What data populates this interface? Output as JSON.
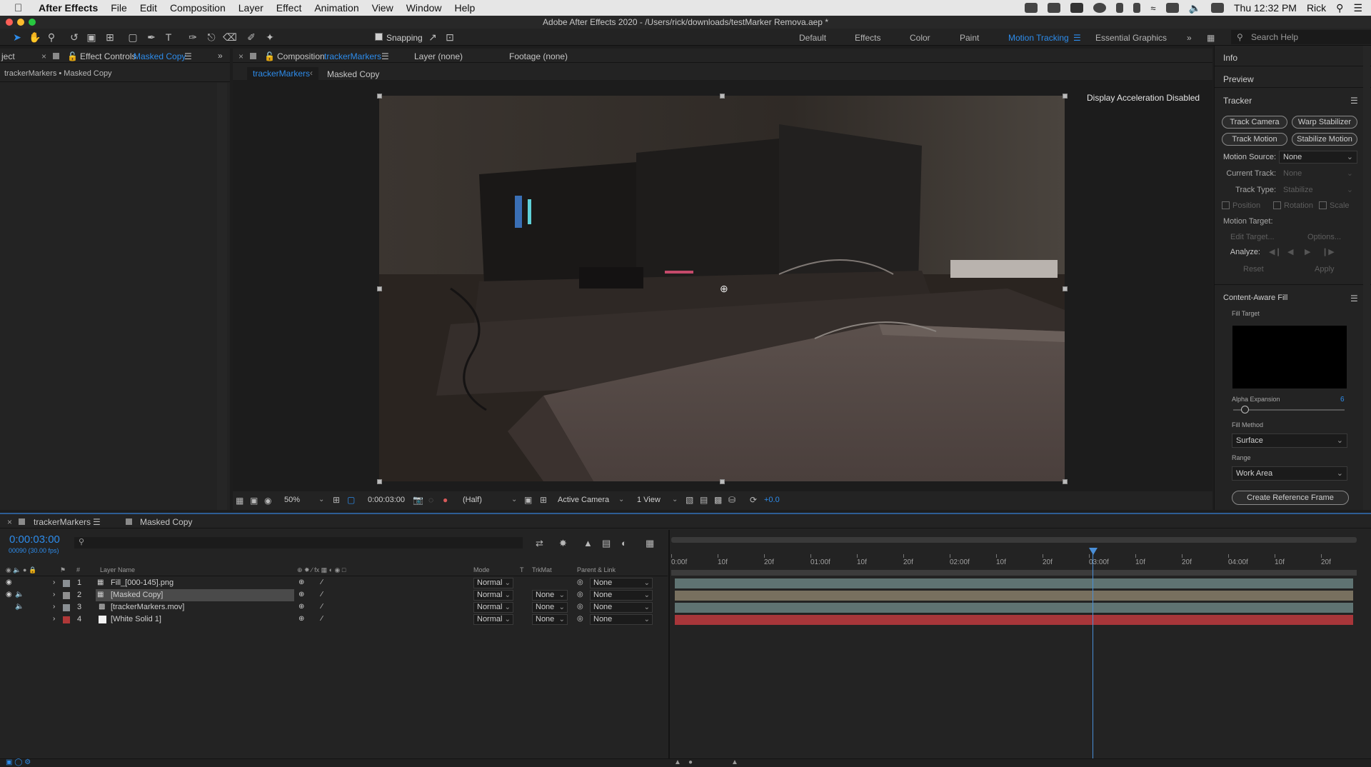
{
  "menubar": {
    "app_name": "After Effects",
    "items": [
      "File",
      "Edit",
      "Composition",
      "Layer",
      "Effect",
      "Animation",
      "View",
      "Window",
      "Help"
    ],
    "clock": "Thu 12:32 PM",
    "user": "Rick"
  },
  "window": {
    "title": "Adobe After Effects 2020 - /Users/rick/downloads/testMarker Remova.aep *"
  },
  "toolbar": {
    "snapping_label": "Snapping",
    "workspaces": [
      "Default",
      "Effects",
      "Color",
      "Paint",
      "Motion Tracking",
      "Essential Graphics"
    ],
    "active_workspace": "Motion Tracking",
    "search_placeholder": "Search Help"
  },
  "left_panel": {
    "tab_project": "ject",
    "tab_effect_controls": "Effect Controls",
    "tab_effect_controls_target": "Masked Copy",
    "breadcrumb": "trackerMarkers • Masked Copy"
  },
  "comp_panel": {
    "tab_composition": "Composition",
    "tab_composition_name": "trackerMarkers",
    "tab_layer": "Layer (none)",
    "tab_footage": "Footage (none)",
    "crumb_active": "trackerMarkers",
    "crumb_next": "Masked Copy",
    "overlay_text": "Display Acceleration Disabled"
  },
  "viewer_bar": {
    "zoom": "50%",
    "timecode": "0:00:03:00",
    "resolution": "(Half)",
    "camera": "Active Camera",
    "views": "1 View",
    "exposure": "+0.0"
  },
  "right_panel": {
    "info": "Info",
    "preview": "Preview",
    "tracker": {
      "title": "Tracker",
      "buttons": [
        "Track Camera",
        "Warp Stabilizer",
        "Track Motion",
        "Stabilize Motion"
      ],
      "motion_source_label": "Motion Source:",
      "motion_source_value": "None",
      "current_track_label": "Current Track:",
      "current_track_value": "None",
      "track_type_label": "Track Type:",
      "track_type_value": "Stabilize",
      "position": "Position",
      "rotation": "Rotation",
      "scale": "Scale",
      "motion_target_label": "Motion Target:",
      "edit_target": "Edit Target...",
      "options": "Options...",
      "analyze_label": "Analyze:",
      "reset": "Reset",
      "apply": "Apply"
    },
    "caf": {
      "title": "Content-Aware Fill",
      "fill_target": "Fill Target",
      "alpha_expansion_label": "Alpha Expansion",
      "alpha_expansion_value": "6",
      "fill_method_label": "Fill Method",
      "fill_method_value": "Surface",
      "range_label": "Range",
      "range_value": "Work Area",
      "create_ref": "Create Reference Frame"
    }
  },
  "timeline": {
    "tab_comp": "trackerMarkers",
    "tab_other": "Masked Copy",
    "timecode": "0:00:03:00",
    "frame_info": "00090 (30.00 fps)",
    "headers": {
      "num": "#",
      "layer_name": "Layer Name",
      "mode": "Mode",
      "t": "T",
      "trkmat": "TrkMat",
      "parent": "Parent & Link"
    },
    "layers": [
      {
        "num": "1",
        "name": "Fill_[000-145].png",
        "mode": "Normal",
        "trkmat": "",
        "parent": "None",
        "color": "#8a8f93"
      },
      {
        "num": "2",
        "name": "[Masked Copy]",
        "mode": "Normal",
        "trkmat": "None",
        "parent": "None",
        "color": "#8f8f8f"
      },
      {
        "num": "3",
        "name": "[trackerMarkers.mov]",
        "mode": "Normal",
        "trkmat": "None",
        "parent": "None",
        "color": "#8a8f93"
      },
      {
        "num": "4",
        "name": "[White Solid 1]",
        "mode": "Normal",
        "trkmat": "None",
        "parent": "None",
        "color": "#b03838"
      }
    ],
    "ruler": [
      "0:00f",
      "10f",
      "20f",
      "01:00f",
      "10f",
      "20f",
      "02:00f",
      "10f",
      "20f",
      "03:00f",
      "10f",
      "20f",
      "04:00f",
      "10f",
      "20f"
    ]
  },
  "colors": {
    "accent": "#2d8ceb",
    "playhead": "#4a8fd8",
    "layer_bar_teal": "#5f7372",
    "layer_bar_brown": "#78705f",
    "layer_bar_red": "#a8363a"
  }
}
